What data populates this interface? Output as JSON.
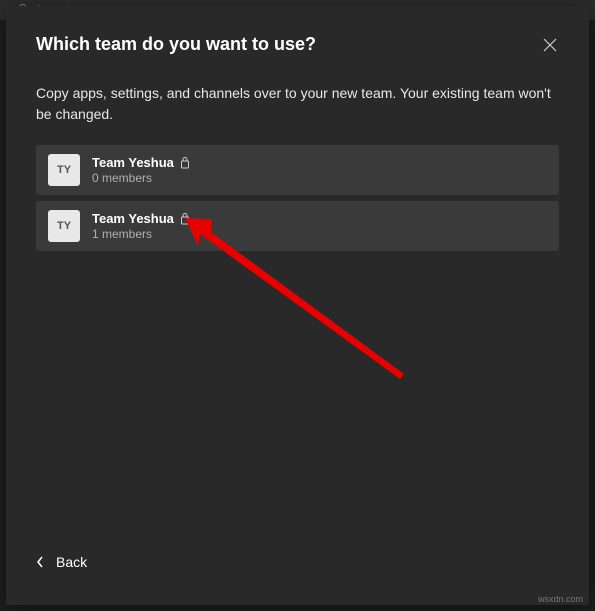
{
  "background": {
    "search_placeholder": "Search"
  },
  "modal": {
    "title": "Which team do you want to use?",
    "description": "Copy apps, settings, and channels over to your new team. Your existing team won't be changed."
  },
  "teams": [
    {
      "initials": "TY",
      "name": "Team Yeshua",
      "members": "0 members"
    },
    {
      "initials": "TY",
      "name": "Team Yeshua",
      "members": "1 members"
    }
  ],
  "footer": {
    "back": "Back"
  },
  "watermark": "wsxdn.com"
}
